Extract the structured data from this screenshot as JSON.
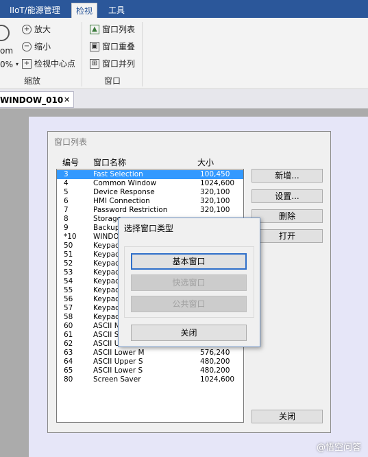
{
  "ribbon_tabs": [
    "IIoT/能源管理",
    "检视",
    "工具"
  ],
  "ribbon": {
    "zoom_partial": "om",
    "zoom_value_partial": "0%",
    "zoom_in": "放大",
    "zoom_out": "缩小",
    "view_center": "检视中心点",
    "group_zoom": "缩放",
    "window_list": "窗口列表",
    "window_overlap": "窗口重叠",
    "window_tile": "窗口并列",
    "group_window": "窗口"
  },
  "doc_tab": {
    "label": "WINDOW_010",
    "close": "✕"
  },
  "dialog": {
    "title": "窗口列表",
    "col_number": "编号",
    "col_name": "窗口名称",
    "col_size": "大小",
    "buttons": {
      "new": "新增...",
      "settings": "设置...",
      "delete": "删除",
      "open": "打开",
      "close": "关闭"
    },
    "rows": [
      {
        "no": "3",
        "name": "Fast Selection",
        "size": "100,450",
        "selected": true
      },
      {
        "no": "4",
        "name": "Common Window",
        "size": "1024,600"
      },
      {
        "no": "5",
        "name": "Device Response",
        "size": "320,100"
      },
      {
        "no": "6",
        "name": "HMI Connection",
        "size": "320,100"
      },
      {
        "no": "7",
        "name": "Password Restriction",
        "size": "320,100"
      },
      {
        "no": "8",
        "name": "Storage",
        "size": ""
      },
      {
        "no": "9",
        "name": "Backup",
        "size": ""
      },
      {
        "no": "*10",
        "name": "WINDO",
        "size": ""
      },
      {
        "no": "50",
        "name": "Keypad",
        "size": ""
      },
      {
        "no": "51",
        "name": "Keypad",
        "size": ""
      },
      {
        "no": "52",
        "name": "Keypad",
        "size": ""
      },
      {
        "no": "53",
        "name": "Keypad",
        "size": ""
      },
      {
        "no": "54",
        "name": "Keypad",
        "size": ""
      },
      {
        "no": "55",
        "name": "Keypad",
        "size": ""
      },
      {
        "no": "56",
        "name": "Keypad",
        "size": ""
      },
      {
        "no": "57",
        "name": "Keypad",
        "size": ""
      },
      {
        "no": "58",
        "name": "Keypad",
        "size": ""
      },
      {
        "no": "60",
        "name": "ASCII N",
        "size": ""
      },
      {
        "no": "61",
        "name": "ASCII S",
        "size": ""
      },
      {
        "no": "62",
        "name": "ASCII U",
        "size": ""
      },
      {
        "no": "63",
        "name": "ASCII Lower M",
        "size": "576,240"
      },
      {
        "no": "64",
        "name": "ASCII Upper S",
        "size": "480,200"
      },
      {
        "no": "65",
        "name": "ASCII Lower S",
        "size": "480,200"
      },
      {
        "no": "80",
        "name": "Screen Saver",
        "size": "1024,600"
      }
    ]
  },
  "popup": {
    "title": "选择窗口类型",
    "basic": "基本窗口",
    "fast": "快选窗口",
    "public": "公共窗口",
    "close": "关闭"
  },
  "watermark": "@悟空问答",
  "colors": {
    "ribbon_blue": "#2b579a",
    "selection": "#3399ff",
    "focus": "#2f6fc9"
  }
}
